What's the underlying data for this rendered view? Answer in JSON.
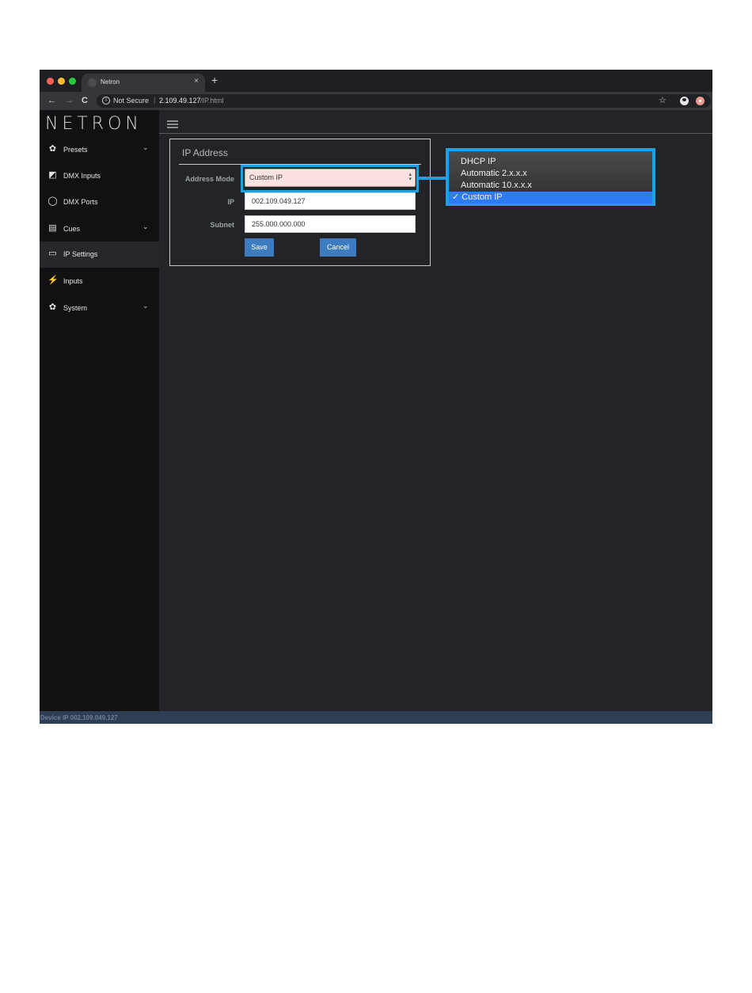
{
  "browser": {
    "tab_title": "Netron",
    "tab_close": "×",
    "new_tab": "+",
    "back": "←",
    "forward": "→",
    "reload": "C",
    "not_secure": "Not Secure",
    "url_separator": "|",
    "url_host": "2.109.49.127",
    "url_path": "/IP.html",
    "star": "☆",
    "info": "i"
  },
  "sidebar": {
    "logo": "NETRON",
    "items": [
      {
        "label": "Presets",
        "icon": "gear-icon",
        "glyph": "✿",
        "chevron": "⌄"
      },
      {
        "label": "DMX Inputs",
        "icon": "input-box-icon",
        "glyph": "◩"
      },
      {
        "label": "DMX Ports",
        "icon": "circle-icon",
        "glyph": "◯"
      },
      {
        "label": "Cues",
        "icon": "film-icon",
        "glyph": "▤",
        "chevron": "⌄"
      },
      {
        "label": "IP Settings",
        "icon": "laptop-icon",
        "glyph": "▭",
        "active": true
      },
      {
        "label": "Inputs",
        "icon": "plug-icon",
        "glyph": "⚡"
      },
      {
        "label": "System",
        "icon": "gear-icon",
        "glyph": "✿",
        "chevron": "⌄"
      }
    ]
  },
  "panel": {
    "title": "IP Address",
    "address_mode_label": "Address Mode",
    "address_mode_value": "Custom IP",
    "ip_label": "IP",
    "ip_value": "002.109.049.127",
    "subnet_label": "Subnet",
    "subnet_value": "255.000.000.000",
    "save_label": "Save",
    "cancel_label": "Cancel"
  },
  "dropdown": {
    "options": [
      {
        "label": "DHCP IP"
      },
      {
        "label": "Automatic 2.x.x.x"
      },
      {
        "label": "Automatic 10.x.x.x"
      },
      {
        "label": "✓ Custom IP",
        "selected": true
      }
    ]
  },
  "status": {
    "text": "Device IP 002.109.049.127"
  },
  "colors": {
    "accent": "#1ea1e3",
    "button": "#3d7cc0",
    "selected_option": "#2d7cf6",
    "page_background": "#222428",
    "sidebar_background": "#111113"
  }
}
